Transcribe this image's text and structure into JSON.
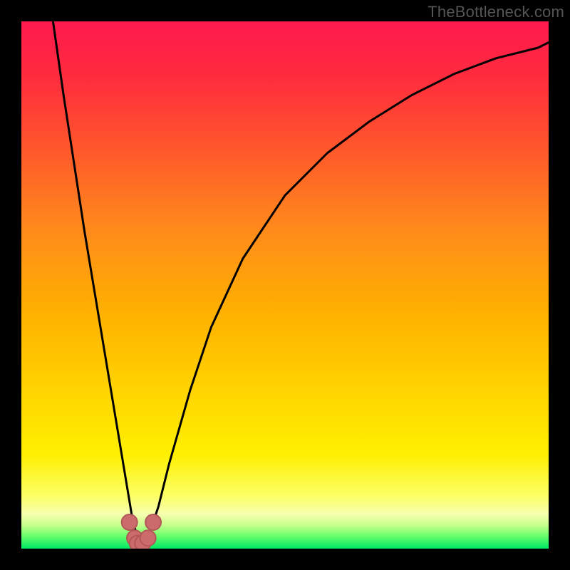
{
  "watermark": "TheBottleneck.com",
  "colors": {
    "gradient_stops": [
      {
        "offset": 0.0,
        "color": "#ff1a4d"
      },
      {
        "offset": 0.1,
        "color": "#ff2a3f"
      },
      {
        "offset": 0.25,
        "color": "#ff5a2a"
      },
      {
        "offset": 0.4,
        "color": "#ff8c1a"
      },
      {
        "offset": 0.55,
        "color": "#ffb000"
      },
      {
        "offset": 0.7,
        "color": "#ffd400"
      },
      {
        "offset": 0.82,
        "color": "#fff000"
      },
      {
        "offset": 0.9,
        "color": "#fcff66"
      },
      {
        "offset": 0.935,
        "color": "#f6ffb0"
      },
      {
        "offset": 0.955,
        "color": "#c8ff8c"
      },
      {
        "offset": 0.975,
        "color": "#6cff6c"
      },
      {
        "offset": 1.0,
        "color": "#00e865"
      }
    ],
    "curve": "#000000",
    "marker_fill": "#cc6b6b",
    "marker_stroke": "#b25757"
  },
  "chart_data": {
    "type": "line",
    "title": "",
    "xlabel": "",
    "ylabel": "",
    "xlim": [
      0,
      100
    ],
    "ylim": [
      0,
      100
    ],
    "series": [
      {
        "name": "bottleneck-curve",
        "x": [
          6,
          8,
          10,
          12,
          14,
          16,
          18,
          20,
          21,
          22,
          23,
          24,
          26,
          28,
          32,
          36,
          42,
          50,
          58,
          66,
          74,
          82,
          90,
          98,
          100
        ],
        "y": [
          100,
          86,
          73,
          60,
          48,
          36,
          24,
          12,
          6,
          2,
          1,
          2,
          8,
          16,
          30,
          42,
          55,
          67,
          75,
          81,
          86,
          90,
          93,
          95,
          96
        ]
      }
    ],
    "markers": {
      "name": "bottleneck-minimum",
      "x": [
        20.5,
        21.5,
        22.0,
        23.0,
        24.0,
        25.0
      ],
      "y": [
        5,
        2,
        1,
        1,
        2,
        5
      ]
    }
  }
}
